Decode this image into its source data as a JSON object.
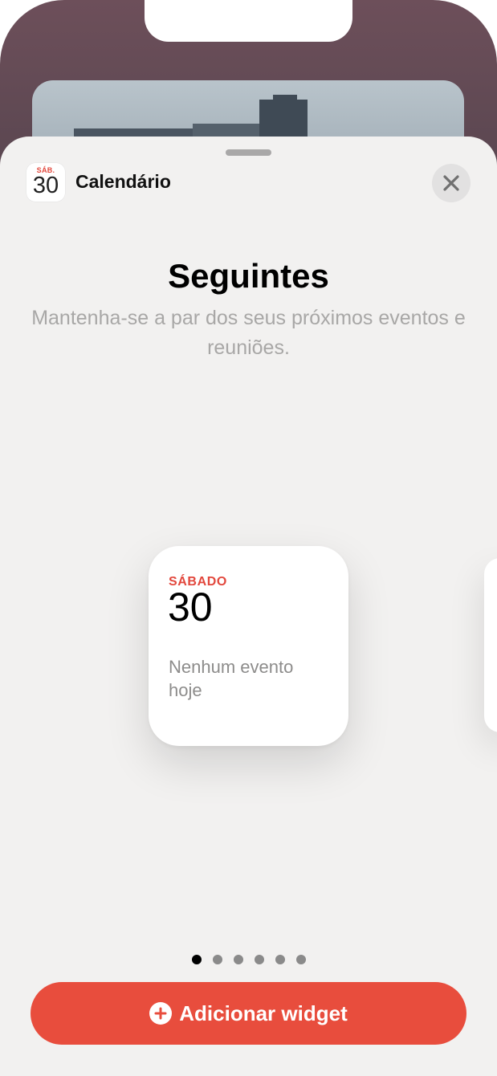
{
  "header": {
    "app_icon": {
      "day": "SÁB.",
      "date": "30",
      "accent_color": "#e2473c"
    },
    "app_name": "Calendário",
    "close_icon": "close-icon"
  },
  "main": {
    "title": "Seguintes",
    "subtitle": "Mantenha-se a par dos seus próximos eventos e reuniões."
  },
  "widget": {
    "day": "SÁBADO",
    "date": "30",
    "message": "Nenhum evento hoje"
  },
  "pagination": {
    "count": 6,
    "active_index": 0
  },
  "add_button": {
    "label": "Adicionar widget",
    "icon": "plus-circle-icon",
    "color": "#e84d3d"
  }
}
